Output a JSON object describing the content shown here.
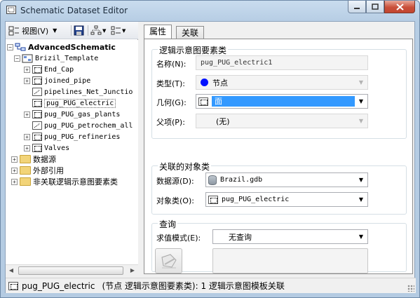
{
  "window": {
    "title": "Schematic Dataset Editor"
  },
  "toolbar": {
    "view_label": "视图(V)"
  },
  "tree": {
    "root": "AdvancedSchematic",
    "template": "Brizil_Template",
    "items": [
      "End_Cap",
      "joined_pipe",
      "pipelines_Net_Junctio",
      "pug_PUG_electric",
      "pug_PUG_gas_plants",
      "pug_PUG_petrochem_all",
      "pug_PUG_refineries",
      "Valves"
    ],
    "folders": [
      "数据源",
      "外部引用",
      "非关联逻辑示意图要素类"
    ]
  },
  "tabs": [
    "属性",
    "关联"
  ],
  "group1": {
    "title": "逻辑示意图要素类",
    "name_label": "名称(N):",
    "name_value": "pug_PUG_electric1",
    "type_label": "类型(T):",
    "type_value": "节点",
    "geometry_label": "几何(G):",
    "geometry_value": "面",
    "parent_label": "父项(P):",
    "parent_value": "(无)"
  },
  "group2": {
    "title": "关联的对象类",
    "datasource_label": "数据源(D):",
    "datasource_value": "Brazil.gdb",
    "class_label": "对象类(O):",
    "class_value": "pug_PUG_electric"
  },
  "group3": {
    "title": "查询",
    "eval_label": "求值模式(E):",
    "eval_value": "无查询"
  },
  "status": {
    "name": "pug_PUG_electric",
    "detail": "(节点 逻辑示意图要素类): 1 逻辑示意图模板关联"
  },
  "colors": {
    "selection": "#3399ff",
    "node_type": "#0011ff"
  }
}
